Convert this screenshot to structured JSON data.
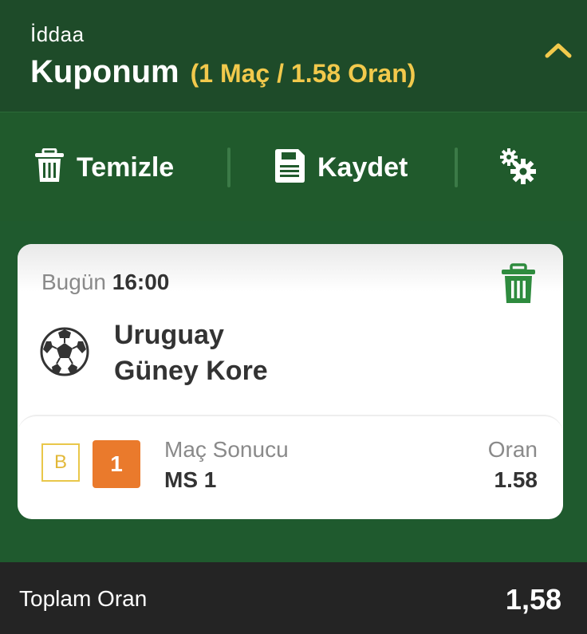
{
  "header": {
    "subtitle": "İddaa",
    "title": "Kuponum",
    "summary": "(1 Maç / 1.58 Oran)",
    "collapse_icon": "chevron-up-icon",
    "accent_color": "#f2c94c"
  },
  "toolbar": {
    "clear_label": "Temizle",
    "clear_icon": "trash-icon",
    "save_label": "Kaydet",
    "save_icon": "save-icon",
    "settings_icon": "gears-icon"
  },
  "bet": {
    "day": "Bugün",
    "time": "16:00",
    "delete_icon": "trash-icon",
    "sport_icon": "soccer-ball-icon",
    "home_team": "Uruguay",
    "away_team": "Güney Kore",
    "badge_b": "B",
    "selection_code": "1",
    "market_label": "Maç Sonucu",
    "pick": "MS 1",
    "odds_label": "Oran",
    "odds_value": "1.58"
  },
  "footer": {
    "total_label": "Toplam Oran",
    "total_value": "1,58"
  },
  "colors": {
    "header_bg": "#1e4b29",
    "toolbar_bg": "#205a2c",
    "delete_green": "#2e8b3e",
    "code_orange": "#ea7a2c",
    "footer_bg": "#242424"
  }
}
